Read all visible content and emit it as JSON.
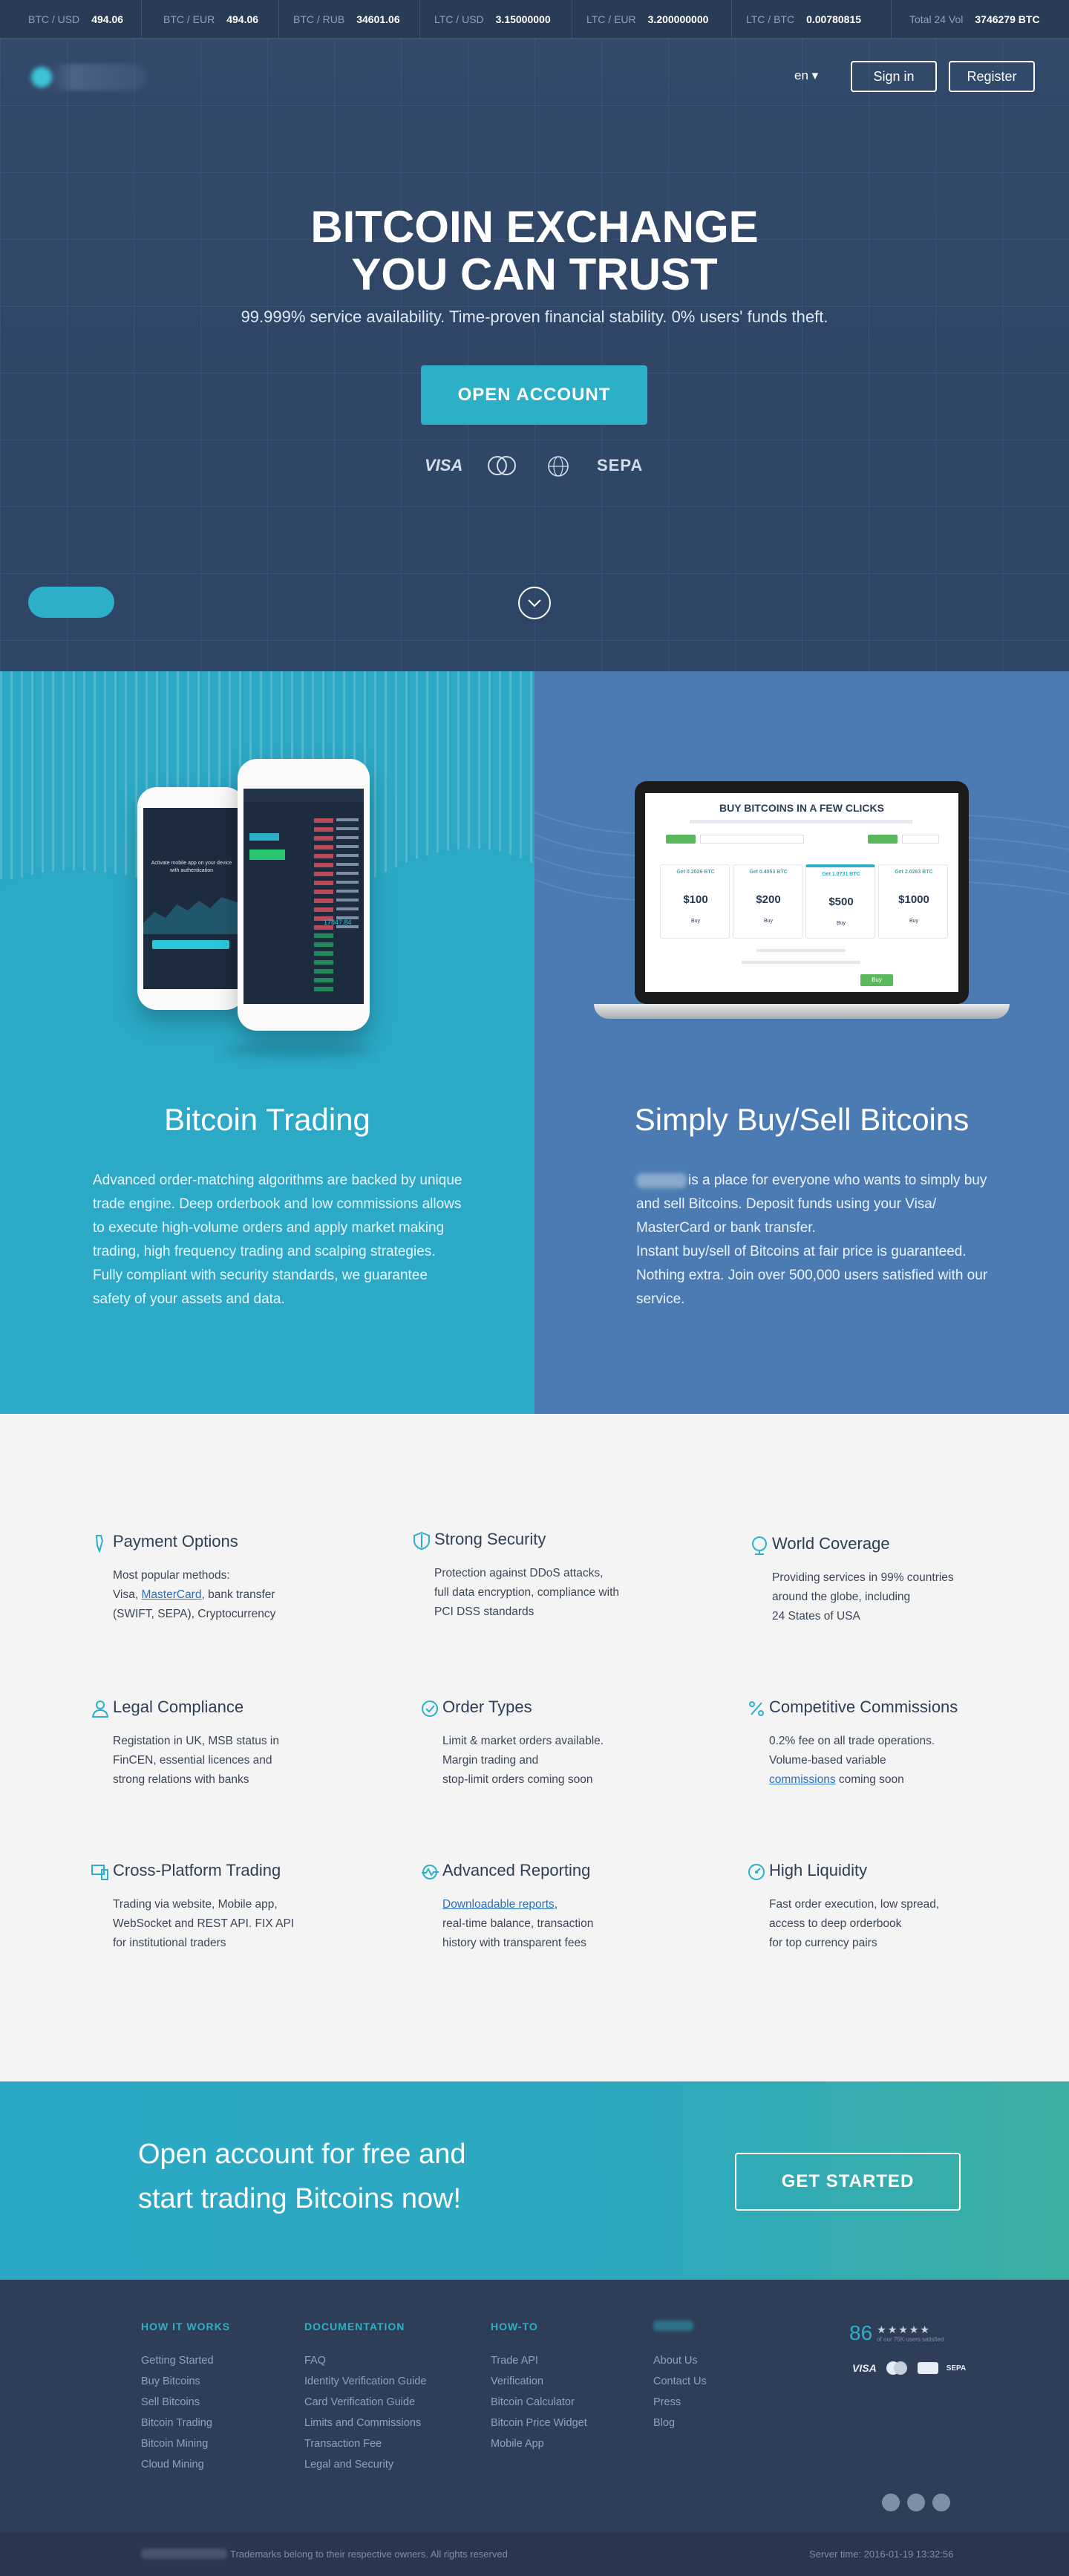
{
  "ticker": [
    {
      "pair": "BTC / USD",
      "value": "494.06"
    },
    {
      "pair": "BTC / EUR",
      "value": "494.06"
    },
    {
      "pair": "BTC / RUB",
      "value": "34601.06"
    },
    {
      "pair": "LTC / USD",
      "value": "3.15000000"
    },
    {
      "pair": "LTC / EUR",
      "value": "3.200000000"
    },
    {
      "pair": "LTC / BTC",
      "value": "0.00780815"
    },
    {
      "pair": "Total 24 Vol",
      "value": "3746279 BTC"
    }
  ],
  "header": {
    "lang": "en ▾",
    "sign_in": "Sign in",
    "register": "Register"
  },
  "hero": {
    "title_line1": "BITCOIN EXCHANGE",
    "title_line2": "YOU CAN TRUST",
    "subtitle": "99.999% service availability. Time-proven financial stability. 0% users' funds theft.",
    "cta": "OPEN ACCOUNT",
    "payments": [
      "VISA",
      "MasterCard",
      "Web",
      "SEPA"
    ]
  },
  "features_left": {
    "title": "Bitcoin Trading",
    "text": "Advanced order-matching algorithms are backed by unique trade engine. Deep orderbook and low commissions allows to execute high-volume orders and apply market making trading, high frequency trading and scalping strategies. Fully compliant with security standards, we guarantee safety of your assets and data.",
    "phone_small_text": "Activate mobile app on your device with authentication",
    "phone_price": "17847.84"
  },
  "features_right": {
    "title": "Simply Buy/Sell Bitcoins",
    "text": "is a place for everyone who wants to simply buy and sell Bitcoins. Deposit funds using your Visa/ MasterCard or bank transfer.",
    "text2": "Instant buy/sell of Bitcoins at fair price is guaranteed. Nothing extra. Join over 500,000 users satisfied with our service.",
    "laptop_title": "BUY BITCOINS IN A FEW CLICKS",
    "laptop_cards": [
      {
        "amount": "$100",
        "header": "Get 0.2026 BTC",
        "buy": "Buy"
      },
      {
        "amount": "$200",
        "header": "Get 0.4053 BTC",
        "buy": "Buy"
      },
      {
        "amount": "$500",
        "header": "Get 1.0731 BTC",
        "buy": "Buy"
      },
      {
        "amount": "$1000",
        "header": "Get 2.0263 BTC",
        "buy": "Buy"
      }
    ],
    "laptop_buy_btn": "Buy"
  },
  "grid": [
    {
      "title": "Payment Options",
      "icon": "card-icon",
      "lines": [
        "Most popular methods:",
        "Visa, |MasterCard|, bank transfer",
        "(SWIFT, SEPA), Cryptocurrency"
      ],
      "link": "MasterCard"
    },
    {
      "title": "Strong Security",
      "icon": "shield-icon",
      "lines": [
        "Protection against DDoS attacks,",
        "full data encryption, compliance with",
        "PCI DSS standards"
      ]
    },
    {
      "title": "World Coverage",
      "icon": "globe-icon",
      "lines": [
        "Providing services in 99% countries",
        "around the globe, including",
        "24 States of USA"
      ]
    },
    {
      "title": "Legal Compliance",
      "icon": "person-icon",
      "lines": [
        "Registation in UK, MSB status in",
        "FinCEN, essential licences and",
        "strong relations with banks"
      ]
    },
    {
      "title": "Order Types",
      "icon": "check-circle-icon",
      "lines": [
        "Limit & market orders available.",
        "Margin trading and",
        "stop-limit orders coming soon"
      ]
    },
    {
      "title": "Competitive Commissions",
      "icon": "percent-icon",
      "lines": [
        "0.2% fee on all trade operations.",
        "Volume-based variable",
        "|commissions| coming soon"
      ],
      "link": "commissions"
    },
    {
      "title": "Cross-Platform Trading",
      "icon": "devices-icon",
      "lines": [
        "Trading via website, Mobile app,",
        "WebSocket and REST API. FIX API",
        "for institutional traders"
      ]
    },
    {
      "title": "Advanced Reporting",
      "icon": "chart-icon",
      "lines": [
        "|Downloadable reports|,",
        "real-time balance, transaction",
        "history with transparent fees"
      ],
      "link": "Downloadable reports"
    },
    {
      "title": "High Liquidity",
      "icon": "gauge-icon",
      "lines": [
        "Fast order execution, low spread,",
        "access to deep orderbook",
        "for top currency pairs"
      ]
    }
  ],
  "cta": {
    "line1": "Open account for free and",
    "line2": "start trading Bitcoins now!",
    "button": "GET STARTED"
  },
  "footer": {
    "columns": [
      {
        "heading": "HOW IT WORKS",
        "links": [
          "Getting Started",
          "Buy Bitcoins",
          "Sell Bitcoins",
          "Bitcoin Trading",
          "Bitcoin Mining",
          "Cloud Mining"
        ]
      },
      {
        "heading": "DOCUMENTATION",
        "links": [
          "FAQ",
          "Identity Verification Guide",
          "Card Verification Guide",
          "Limits and Commissions",
          "Transaction Fee",
          "Legal and Security"
        ]
      },
      {
        "heading": "HOW-TO",
        "links": [
          "Trade API",
          "Verification",
          "Bitcoin Calculator",
          "Bitcoin Price Widget",
          "Mobile App"
        ]
      },
      {
        "heading": "",
        "links": [
          "About Us",
          "Contact Us",
          "Press",
          "Blog"
        ]
      }
    ],
    "rating": "86",
    "stars": "★★★★★",
    "rating_caption": "of our 75K users satisfied",
    "pay": [
      "VISA",
      "MC",
      "SEPA"
    ],
    "trademarks": "Trademarks belong to their respective owners. All rights reserved",
    "server_time": "Server time: 2016-01-19 13:32:56"
  }
}
